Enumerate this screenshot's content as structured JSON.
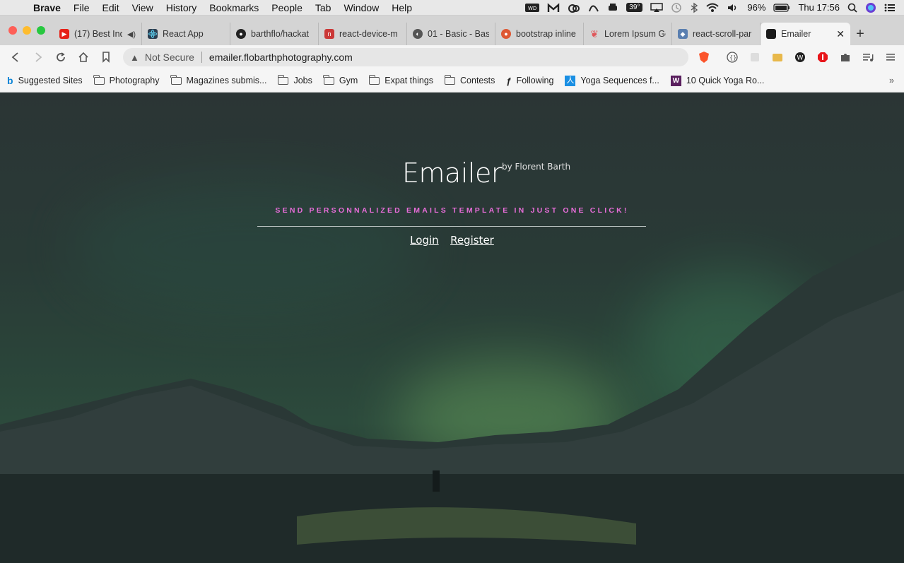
{
  "menubar": {
    "items": [
      "Brave",
      "File",
      "Edit",
      "View",
      "History",
      "Bookmarks",
      "People",
      "Tab",
      "Window",
      "Help"
    ],
    "temp": "39°",
    "battery": "96%",
    "clock": "Thu 17:56"
  },
  "tabs": [
    {
      "label": "(17) Best Ind",
      "favicon": "youtube-icon",
      "color": "#e62117"
    },
    {
      "label": "React App",
      "favicon": "react-icon",
      "color": "#2c3e50"
    },
    {
      "label": "barthflo/hackat",
      "favicon": "github-icon",
      "color": "#222222"
    },
    {
      "label": "react-device-m",
      "favicon": "npm-icon",
      "color": "#cb3837"
    },
    {
      "label": "01 - Basic - Bas",
      "favicon": "globe-icon",
      "color": "#555555"
    },
    {
      "label": "bootstrap inline",
      "favicon": "duckduckgo-icon",
      "color": "#de5833"
    },
    {
      "label": "Lorem Ipsum Ge",
      "favicon": "lorem-icon",
      "color": "#e0575b"
    },
    {
      "label": "react-scroll-par",
      "favicon": "shield-icon",
      "color": "#5a7fb0"
    },
    {
      "label": "Emailer",
      "favicon": "emailer-icon",
      "color": "#1b1b1b",
      "active": true
    }
  ],
  "toolbar": {
    "security_label": "Not Secure",
    "url": "emailer.flobarthphotography.com"
  },
  "bookmarks": [
    {
      "label": "Suggested Sites",
      "icon": "bing-icon"
    },
    {
      "label": "Photography",
      "icon": "folder-icon"
    },
    {
      "label": "Magazines submis...",
      "icon": "folder-icon"
    },
    {
      "label": "Jobs",
      "icon": "folder-icon"
    },
    {
      "label": "Gym",
      "icon": "folder-icon"
    },
    {
      "label": "Expat things",
      "icon": "folder-icon"
    },
    {
      "label": "Contests",
      "icon": "folder-icon"
    },
    {
      "label": "Following",
      "icon": "following-icon"
    },
    {
      "label": "Yoga Sequences f...",
      "icon": "yoga-icon"
    },
    {
      "label": "10 Quick Yoga Ro...",
      "icon": "w-icon"
    }
  ],
  "page": {
    "title": "Emailer",
    "byline": "by Florent Barth",
    "tagline": "SEND PERSONNALIZED EMAILS TEMPLATE IN JUST ONE CLICK!",
    "login": "Login",
    "register": "Register",
    "accent_color": "#e86dd9"
  }
}
